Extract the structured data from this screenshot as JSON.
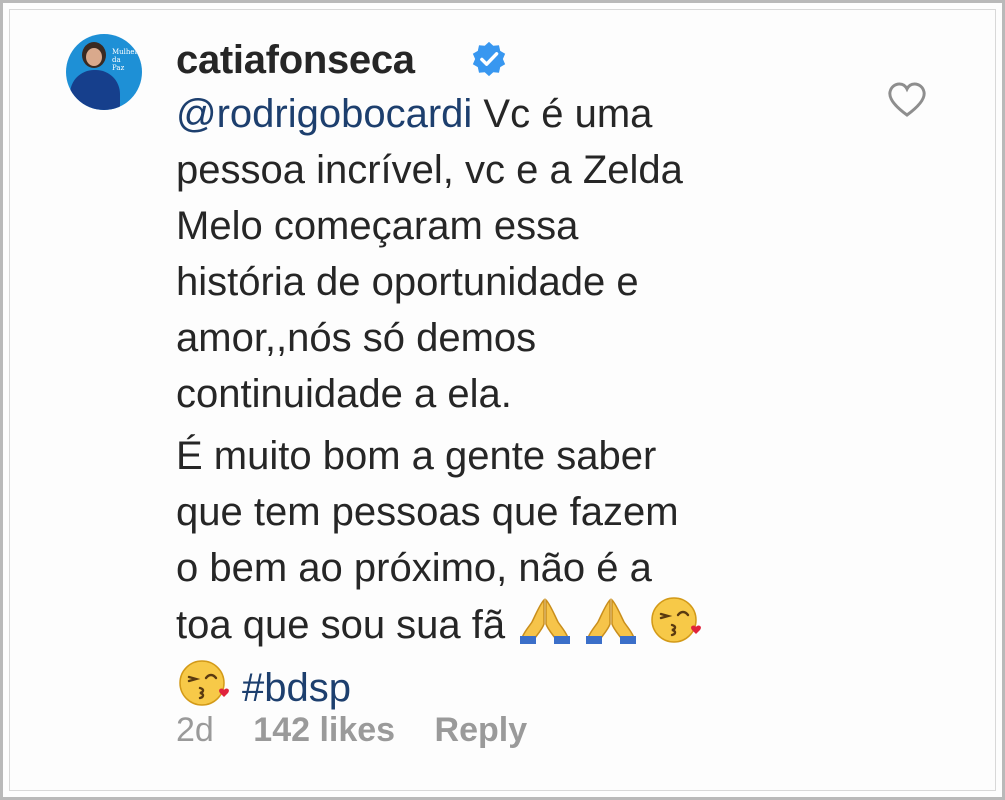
{
  "comment": {
    "username": "catiafonseca",
    "verified": true,
    "mention": "@rodrigobocardi",
    "paragraph1_text": " Vc é uma\npessoa incrível, vc e a Zelda\nMelo começaram essa\nhistória de oportunidade e\namor,,nós só demos\ncontinuidade a ela.",
    "paragraph2_text": "É muito bom a gente saber\nque tem pessoas que fazem\no bem ao próximo, não é a\ntoa que sou sua fã ",
    "hashtag": "#bdsp",
    "emojis": [
      "folded-hands-emoji",
      "folded-hands-emoji",
      "kissing-face-emoji",
      "kissing-face-emoji"
    ],
    "avatar_sign_text": "Mulher\nda Paz"
  },
  "footer": {
    "age": "2d",
    "likes": "142 likes",
    "reply_label": "Reply"
  },
  "colors": {
    "text": "#262626",
    "link": "#1d3f6e",
    "muted": "#9a9a9a",
    "verified_badge": "#3897f0",
    "avatar_bg": "#1e90d6"
  },
  "icons": {
    "like": "heart-outline-icon",
    "verified": "verified-badge-icon"
  }
}
